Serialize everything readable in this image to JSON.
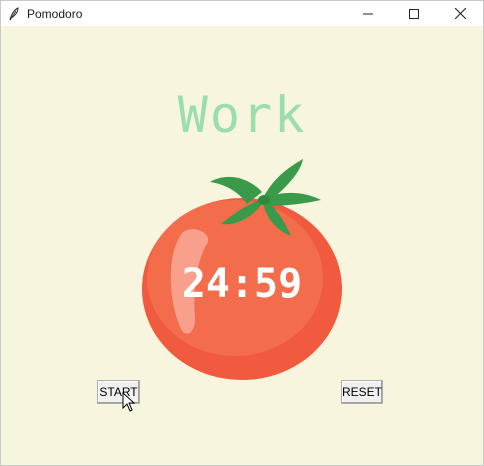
{
  "window": {
    "title": "Pomodoro",
    "icon": "feather-icon",
    "controls": [
      "minimize-icon",
      "maximize-icon",
      "close-icon"
    ]
  },
  "app": {
    "mode_title": "Work",
    "timer": "24:59",
    "start_label": "START",
    "reset_label": "RESET"
  },
  "colors": {
    "background": "#f7f5dd",
    "title_green": "#9bdeac",
    "tomato_red": "#f26849",
    "leaf_green": "#3a9a4a"
  }
}
